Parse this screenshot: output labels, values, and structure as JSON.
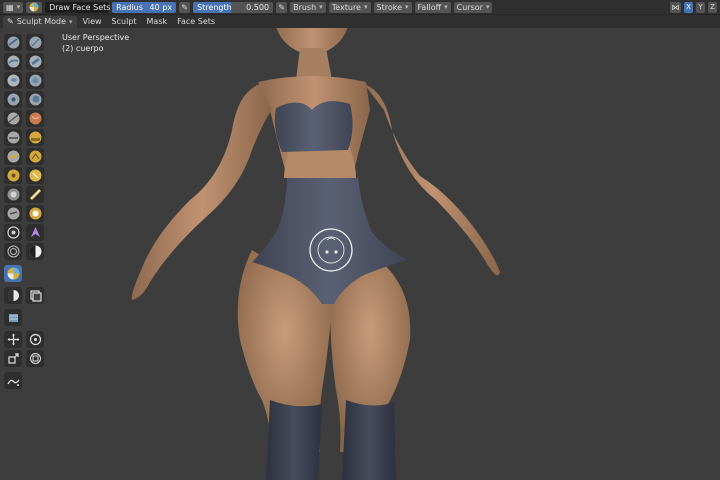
{
  "toolheader": {
    "brush_name": "Draw Face Sets",
    "radius_label": "Radius",
    "radius_value": "40 px",
    "strength_label": "Strength",
    "strength_value": "0.500",
    "menus": [
      "Brush",
      "Texture",
      "Stroke",
      "Falloff",
      "Cursor"
    ],
    "symmetry_axes": [
      "X",
      "Y",
      "Z"
    ]
  },
  "header": {
    "mode": "Sculpt Mode",
    "menus": [
      "View",
      "Sculpt",
      "Mask",
      "Face Sets"
    ]
  },
  "viewport": {
    "perspective_label": "User Perspective",
    "object_label": "(2) cuerpo"
  },
  "colors": {
    "accent": "#4772b3",
    "skin": "#b58a66",
    "cloth": "#545a6c",
    "background": "#3d3d3d"
  }
}
